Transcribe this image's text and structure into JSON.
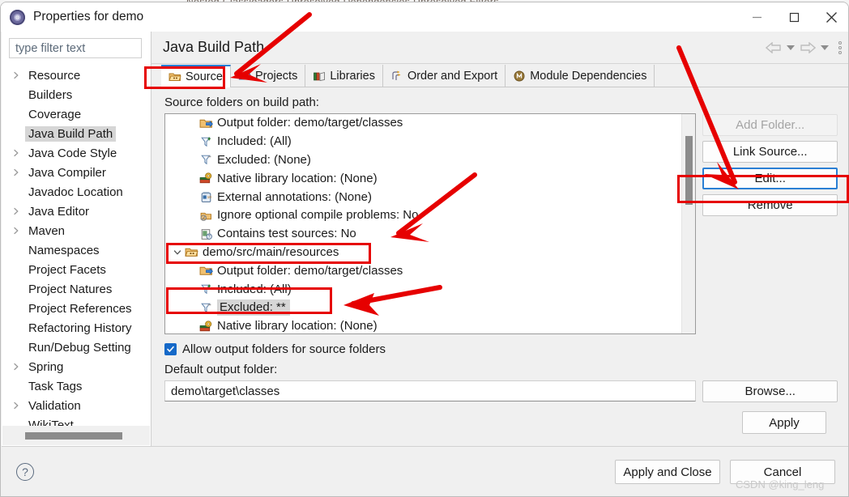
{
  "ghost": {
    "blurred_row": "Nested Classloaders   Unresolved Dependencies   Unresolved Filters"
  },
  "window": {
    "title": "Properties for demo",
    "icon": "eclipse-properties-icon",
    "controls": [
      {
        "name": "minimize",
        "glyph": "minimize-icon"
      },
      {
        "name": "maximize",
        "glyph": "maximize-icon"
      },
      {
        "name": "close",
        "glyph": "close-icon"
      }
    ]
  },
  "sidebar": {
    "filter": {
      "placeholder": "type filter text",
      "value": ""
    },
    "items": [
      {
        "label": "Resource",
        "expandable": true,
        "selected": false
      },
      {
        "label": "Builders",
        "expandable": false,
        "selected": false
      },
      {
        "label": "Coverage",
        "expandable": false,
        "selected": false
      },
      {
        "label": "Java Build Path",
        "expandable": false,
        "selected": true
      },
      {
        "label": "Java Code Style",
        "expandable": true,
        "selected": false
      },
      {
        "label": "Java Compiler",
        "expandable": true,
        "selected": false
      },
      {
        "label": "Javadoc Location",
        "expandable": false,
        "selected": false
      },
      {
        "label": "Java Editor",
        "expandable": true,
        "selected": false
      },
      {
        "label": "Maven",
        "expandable": true,
        "selected": false
      },
      {
        "label": "Namespaces",
        "expandable": false,
        "selected": false
      },
      {
        "label": "Project Facets",
        "expandable": false,
        "selected": false
      },
      {
        "label": "Project Natures",
        "expandable": false,
        "selected": false
      },
      {
        "label": "Project References",
        "expandable": false,
        "selected": false
      },
      {
        "label": "Refactoring History",
        "expandable": false,
        "selected": false
      },
      {
        "label": "Run/Debug Setting",
        "expandable": false,
        "selected": false
      },
      {
        "label": "Spring",
        "expandable": true,
        "selected": false
      },
      {
        "label": "Task Tags",
        "expandable": false,
        "selected": false
      },
      {
        "label": "Validation",
        "expandable": true,
        "selected": false
      },
      {
        "label": "WikiText",
        "expandable": false,
        "selected": false
      }
    ]
  },
  "page": {
    "title": "Java Build Path",
    "nav": {
      "back": "back-arrow-icon",
      "back_menu": "chevron-down-icon",
      "forward": "forward-arrow-icon",
      "forward_menu": "chevron-down-icon",
      "overflow": "view-menu-icon"
    }
  },
  "tabs": [
    {
      "label": "Source",
      "icon": "source-folder-icon",
      "active": true
    },
    {
      "label": "Projects",
      "icon": "projects-icon",
      "active": false
    },
    {
      "label": "Libraries",
      "icon": "libraries-icon",
      "active": false
    },
    {
      "label": "Order and Export",
      "icon": "order-export-icon",
      "active": false
    },
    {
      "label": "Module Dependencies",
      "icon": "module-dependencies-icon",
      "active": false
    }
  ],
  "source_tab": {
    "list_label": "Source folders on build path:",
    "entries": [
      {
        "text": "Output folder: demo/target/classes",
        "icon": "output-folder-icon",
        "level": "child",
        "selected": false
      },
      {
        "text": "Included: (All)",
        "icon": "included-filter-icon",
        "level": "child",
        "selected": false
      },
      {
        "text": "Excluded: (None)",
        "icon": "excluded-filter-icon",
        "level": "child",
        "selected": false
      },
      {
        "text": "Native library location: (None)",
        "icon": "native-library-icon",
        "level": "child",
        "selected": false
      },
      {
        "text": "External annotations: (None)",
        "icon": "external-annotations-icon",
        "level": "child",
        "selected": false
      },
      {
        "text": "Ignore optional compile problems: No",
        "icon": "ignore-problems-icon",
        "level": "child",
        "selected": false
      },
      {
        "text": "Contains test sources: No",
        "icon": "test-sources-icon",
        "level": "child",
        "selected": false
      },
      {
        "text": "demo/src/main/resources",
        "icon": "source-folder-icon",
        "level": "parent",
        "expanded": true,
        "selected": false
      },
      {
        "text": "Output folder: demo/target/classes",
        "icon": "output-folder-icon",
        "level": "child",
        "selected": false
      },
      {
        "text": "Included: (All)",
        "icon": "included-filter-icon",
        "level": "child",
        "selected": false
      },
      {
        "text": "Excluded: **",
        "icon": "excluded-filter-icon",
        "level": "child",
        "selected": true
      },
      {
        "text": "Native library location: (None)",
        "icon": "native-library-icon",
        "level": "child",
        "selected": false
      }
    ],
    "buttons": [
      {
        "label": "Add Folder...",
        "state": "disabled"
      },
      {
        "label": "Link Source...",
        "state": "enabled"
      },
      {
        "label": "Edit...",
        "state": "focused"
      },
      {
        "label": "Remove",
        "state": "enabled"
      }
    ],
    "allow_output_checkbox": {
      "label": "Allow output folders for source folders",
      "checked": true
    },
    "default_output_label": "Default output folder:",
    "default_output_value": "demo\\target\\classes",
    "browse_label": "Browse...",
    "apply_label": "Apply"
  },
  "footer": {
    "help": "?",
    "apply_and_close": "Apply and Close",
    "cancel": "Cancel"
  },
  "watermark": "CSDN @king_leng",
  "colors": {
    "accent": "#2a7fd4",
    "annotation_red": "#e60000",
    "checkbox_blue": "#1669c8",
    "selection_grey": "#d6d6d6",
    "dialog_bg": "#f0f0f0"
  }
}
